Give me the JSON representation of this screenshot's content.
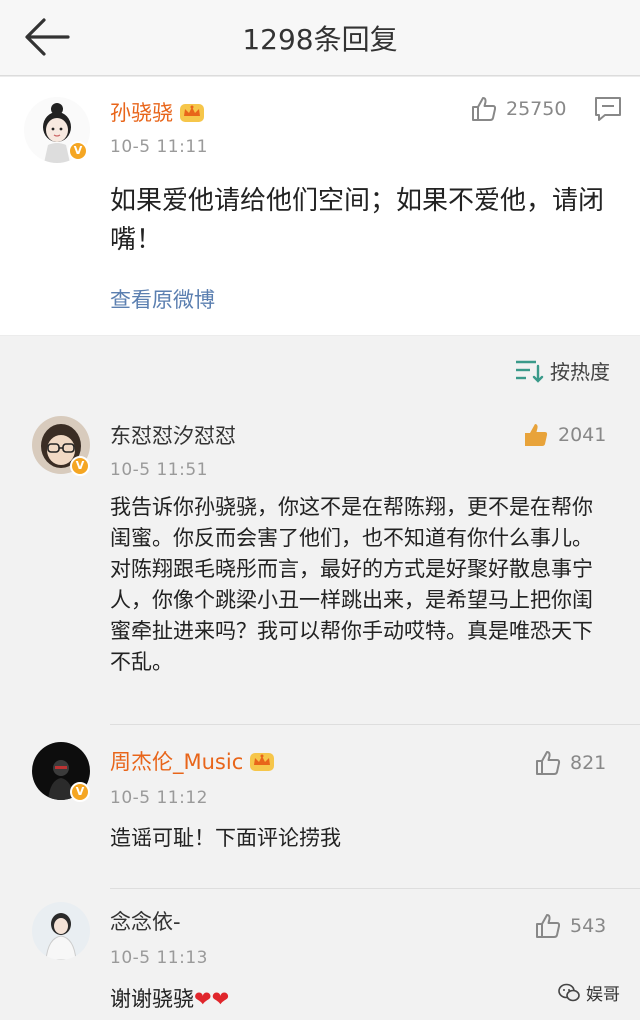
{
  "header": {
    "title": "1298条回复"
  },
  "main_post": {
    "author": "孙骁骁",
    "time": "10-5 11:11",
    "likes": "25750",
    "text": "如果爱他请给他们空间；如果不爱他，请闭嘴！",
    "view_original": "查看原微博"
  },
  "sort": {
    "label": "按热度"
  },
  "comments": [
    {
      "author": "东怼怼汐怼怼",
      "time": "10-5 11:51",
      "likes": "2041",
      "text": "我告诉你孙骁骁，你这不是在帮陈翔，更不是在帮你闺蜜。你反而会害了他们，也不知道有你什么事儿。对陈翔跟毛晓彤而言，最好的方式是好聚好散息事宁人，你像个跳梁小丑一样跳出来，是希望马上把你闺蜜牵扯进来吗？我可以帮你手动哎特。真是唯恐天下不乱。"
    },
    {
      "author": "周杰伦_Music",
      "time": "10-5 11:12",
      "likes": "821",
      "text": "造谣可耻！下面评论捞我"
    },
    {
      "author": "念念依-",
      "time": "10-5 11:13",
      "likes": "543",
      "text": "谢谢骁骁",
      "emoji": "❤❤"
    }
  ],
  "watermark": {
    "label": "娱哥"
  },
  "icons": {
    "back": "back-arrow-icon",
    "crown": "crown-icon",
    "like": "thumbs-up-icon",
    "reply": "comment-icon",
    "sort": "sort-icon",
    "verified": "verified-icon",
    "wechat": "wechat-icon"
  },
  "colors": {
    "vip_name": "#e8651a",
    "link": "#5b7fb0",
    "liked": "#e8a33a",
    "heart": "#e0262c",
    "verified": "#f5a623"
  }
}
